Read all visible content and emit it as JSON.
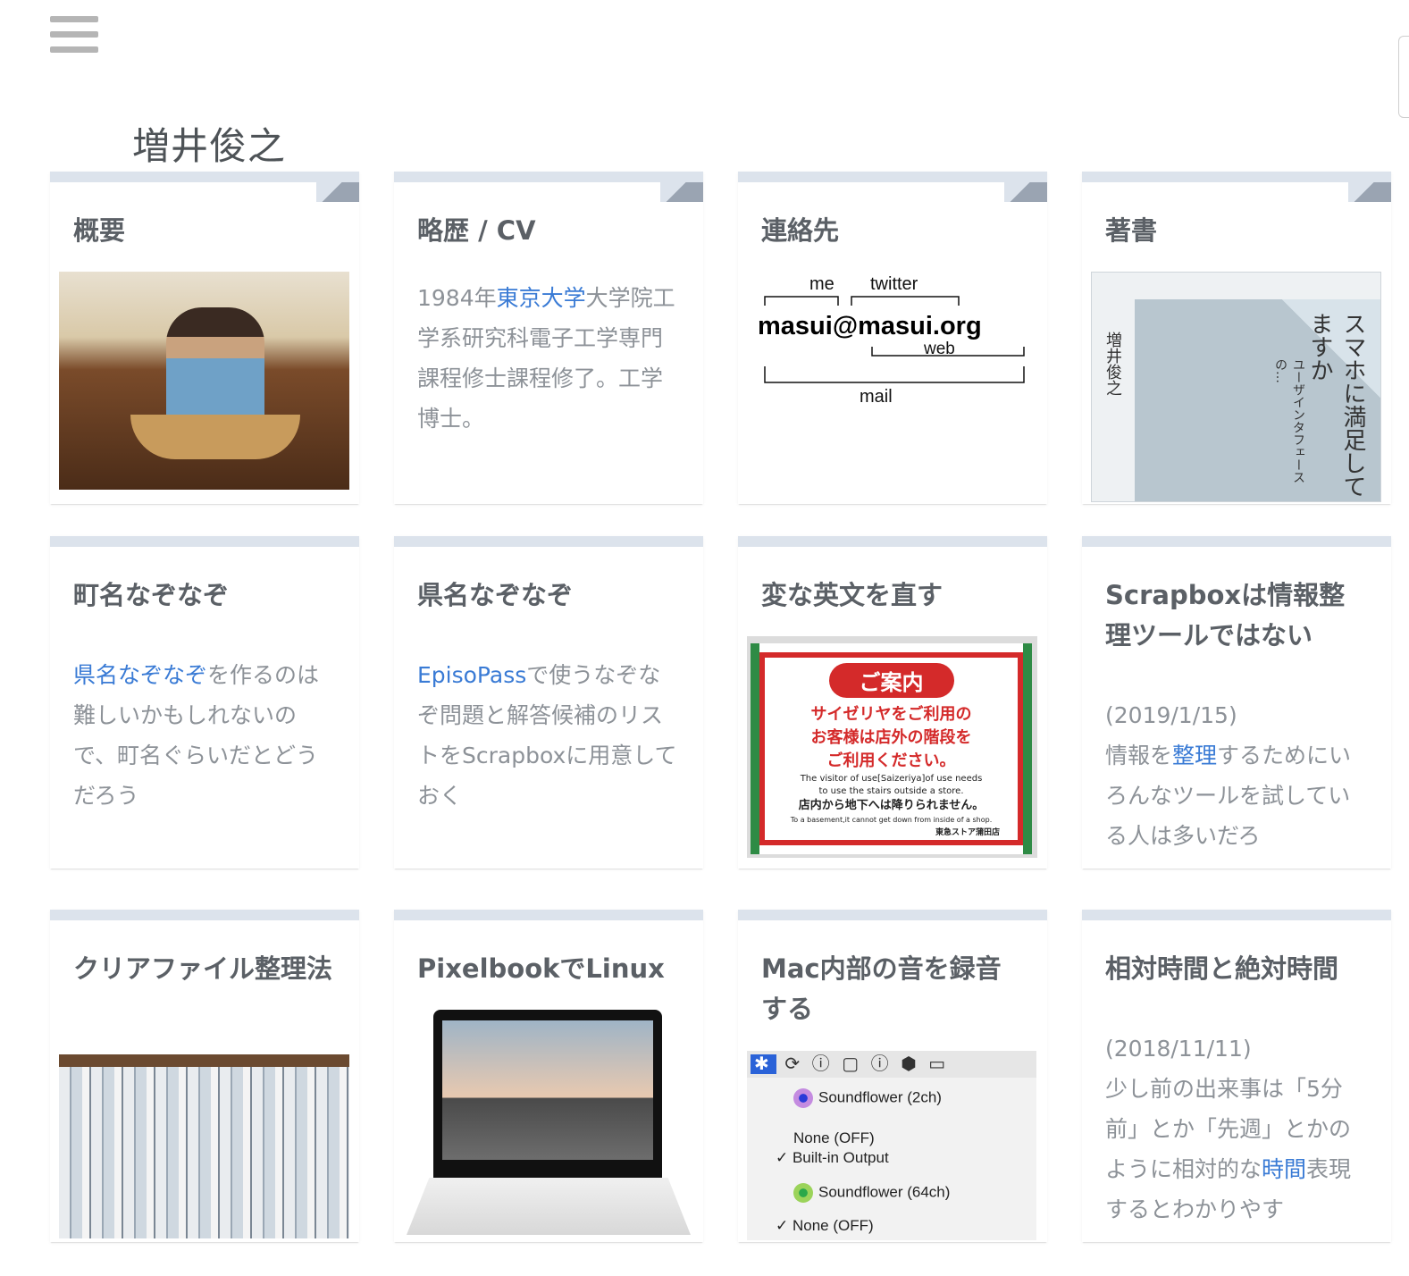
{
  "project_title": "増井俊之",
  "cards": [
    {
      "title": "概要"
    },
    {
      "title": "略歴 / CV",
      "desc_prefix": "1984年",
      "desc_link": "東京大学",
      "desc_suffix": "大学院工学系研究科電子工学専門課程修士課程修了。工学博士。"
    },
    {
      "title": "連絡先",
      "diagram": {
        "me": "me",
        "twitter": "twitter",
        "email": "masui@masui.org",
        "web": "web",
        "mail": "mail"
      }
    },
    {
      "title": "著書",
      "book": {
        "title": "スマホに満足してますか",
        "subtitle": "ユーザインタフェースの…",
        "author": "増井俊之"
      }
    },
    {
      "title": "町名なぞなぞ",
      "desc_link": "県名なぞなぞ",
      "desc_suffix": "を作るのは難しいかもしれないので、町名ぐらいだとどうだろう"
    },
    {
      "title": "県名なぞなぞ",
      "desc_link": "EpisoPass",
      "desc_suffix": "で使うなぞなぞ問題と解答候補のリストをScrapboxに用意しておく"
    },
    {
      "title": "変な英文を直す",
      "sign": {
        "heading": "ご案内",
        "line1": "サイゼリヤをご利用の",
        "line2": "お客様は店外の階段を",
        "line3": "ご利用ください。",
        "en1": "The visitor of use[Saizeriya]of use needs",
        "en2": "to use the stairs outside a store.",
        "jp2": "店内から地下へは降りられません。",
        "en3": "To a basement,it cannot get down from inside of a shop.",
        "foot": "東急ストア蒲田店"
      }
    },
    {
      "title": "Scrapboxは情報整理ツールではない",
      "date": "(2019/1/15)",
      "desc_prefix": "情報を",
      "desc_link": "整理",
      "desc_suffix": "するためにいろんなツールを試している人は多いだろ"
    },
    {
      "title": "クリアファイル整理法"
    },
    {
      "title": "PixelbookでLinux"
    },
    {
      "title": "Mac内部の音を録音する",
      "menu": {
        "item1": "Soundflower (2ch)",
        "item2": "None (OFF)",
        "item3": "✓ Built-in Output",
        "item4": "Soundflower (64ch)",
        "item5": "✓ None (OFF)"
      }
    },
    {
      "title": "相対時間と絶対時間",
      "date": "(2018/11/11)",
      "desc_prefix": "少し前の出来事は「5分前」とか「先週」とかのように相対的な",
      "desc_link": "時間",
      "desc_suffix": "表現するとわかりやす"
    }
  ],
  "icons": [
    "menu-icon",
    "pin-icon"
  ],
  "colors": {
    "link": "#3a7bd5",
    "card_top": "#dce3ec",
    "pin": "#9aa4b2",
    "title": "#5b6066",
    "desc": "#8d9298"
  }
}
